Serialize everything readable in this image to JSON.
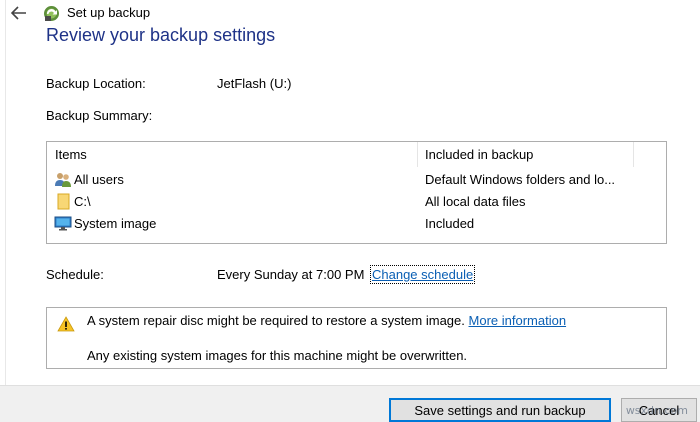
{
  "window": {
    "title": "Set up backup",
    "heading": "Review your backup settings"
  },
  "backup_location": {
    "label": "Backup Location:",
    "value": "JetFlash (U:)"
  },
  "backup_summary": {
    "label": "Backup Summary:"
  },
  "table": {
    "columns": [
      "Items",
      "Included in backup"
    ],
    "rows": [
      {
        "icon": "users-icon",
        "name": "All users",
        "included": "Default Windows folders and lo..."
      },
      {
        "icon": "folder-icon",
        "name": "C:\\",
        "included": "All local data files"
      },
      {
        "icon": "monitor-icon",
        "name": "System image",
        "included": "Included"
      }
    ]
  },
  "schedule": {
    "label": "Schedule:",
    "value": "Every Sunday at 7:00 PM",
    "link": "Change schedule"
  },
  "warning": {
    "icon": "warning-icon",
    "line1": "A system repair disc might be required to restore a system image.",
    "link": "More information",
    "line2": "Any existing system images for this machine might be overwritten."
  },
  "buttons": {
    "save": "Save settings and run backup",
    "cancel": "Cancel"
  },
  "watermark": "wsxdn.com",
  "colors": {
    "heading": "#1e3287",
    "link": "#0a5fb4",
    "primary_border": "#0078d7",
    "warning_yellow": "#f7c325"
  }
}
